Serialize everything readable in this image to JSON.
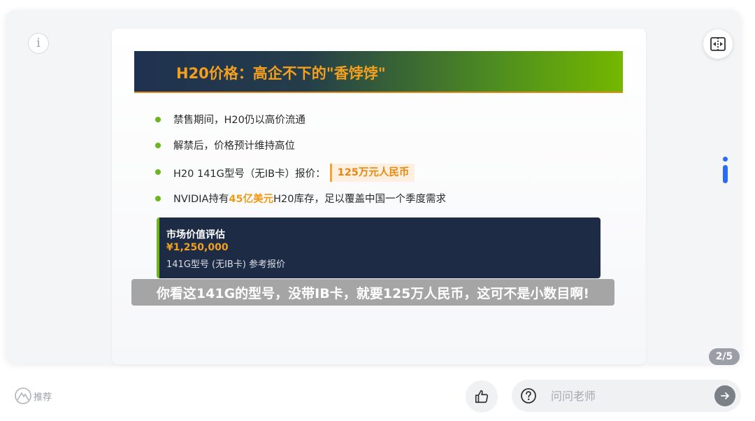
{
  "player": {
    "info_icon_glyph": "i",
    "page_counter": "2/5"
  },
  "slide": {
    "title": "H20价格：高企不下的\"香饽饽\"",
    "bullets": [
      {
        "text": "禁售期间，H20仍以高价流通"
      },
      {
        "text": "解禁后，价格预计维持高位"
      },
      {
        "prefix": "H20 141G型号（无IB卡）报价：",
        "highlight": "125万元人民币"
      },
      {
        "prefix": "NVIDIA持有",
        "highlight": "45亿美元",
        "suffix": "H20库存，足以覆盖中国一个季度需求"
      }
    ],
    "market_box": {
      "title": "市场价值评估",
      "value": "¥1,250,000",
      "note": "141G型号 (无IB卡) 参考报价"
    }
  },
  "subtitle": "你看这141G的型号，没带IB卡，就要125万人民币，这可不是小数目啊!",
  "bottom": {
    "recommend_label": "推荐",
    "ask_placeholder": "问问老师"
  },
  "colors": {
    "accent_orange": "#f09a17",
    "bullet_green": "#6cb51c",
    "box_navy": "#1d2b45",
    "side_blue": "#2a6df4"
  },
  "icons": {
    "info": "info-icon",
    "split": "split-view-icon",
    "side_info": "side-info-icon",
    "recommend": "recommend-icon",
    "like": "thumbs-up-icon",
    "question": "question-icon",
    "send": "arrow-right-icon"
  }
}
